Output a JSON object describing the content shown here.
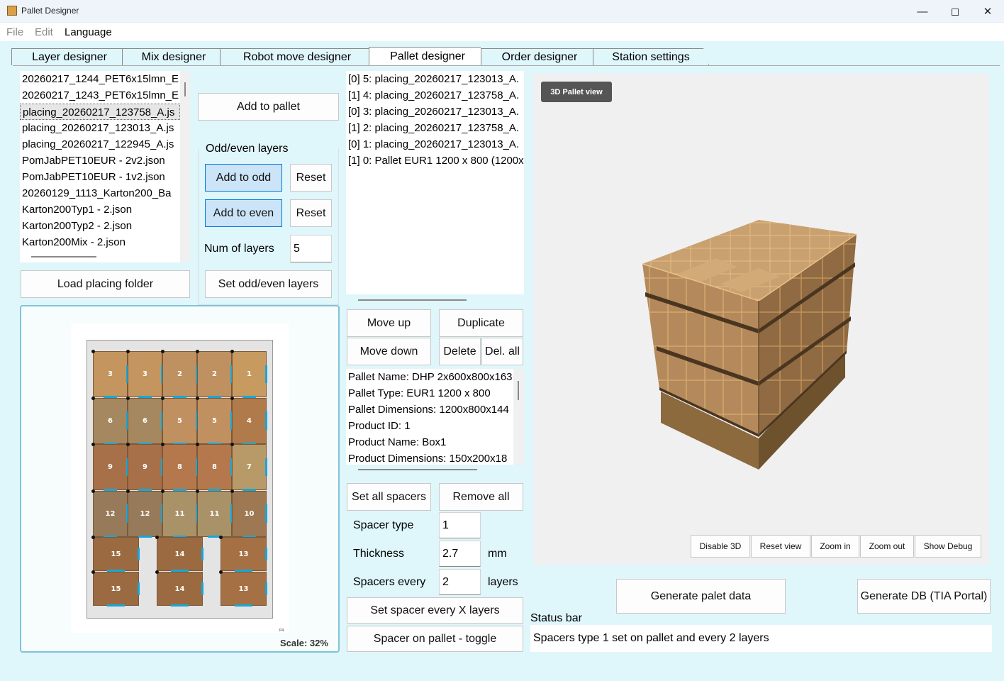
{
  "window": {
    "title": "Pallet Designer",
    "minimize_icon": "minimize-icon",
    "maximize_icon": "maximize-icon",
    "close_icon": "close-icon"
  },
  "menu": {
    "file": "File",
    "edit": "Edit",
    "language": "Language"
  },
  "tabs": [
    {
      "label": "Layer designer"
    },
    {
      "label": "Mix designer"
    },
    {
      "label": "Robot move designer"
    },
    {
      "label": "Pallet designer",
      "active": true
    },
    {
      "label": "Order designer"
    },
    {
      "label": "Station settings"
    }
  ],
  "placing_files": [
    "20260217_1244_PET6x15lmn_E",
    "20260217_1243_PET6x15lmn_E",
    "placing_20260217_123758_A.js",
    "placing_20260217_123013_A.js",
    "placing_20260217_122945_A.js",
    "PomJabPET10EUR - 2v2.json",
    "PomJabPET10EUR - 1v2.json",
    "20260129_1113_Karton200_Ba",
    "Karton200Typ1 - 2.json",
    "Karton200Typ2 - 2.json",
    "Karton200Mix - 2.json"
  ],
  "left": {
    "load_folder": "Load placing folder",
    "add_to_pallet": "Add to pallet"
  },
  "odd_even": {
    "group_title": "Odd/even layers",
    "add_odd": "Add to odd",
    "add_even": "Add to even",
    "reset": "Reset",
    "num_layers_label": "Num of layers",
    "num_layers_value": "5",
    "set_odd_even": "Set odd/even layers"
  },
  "layer_preview": {
    "scale_label": "Scale: 32%",
    "corner_mark": "P4",
    "boxes": [
      {
        "n": "3",
        "c": "#c4955e"
      },
      {
        "n": "3",
        "c": "#c4955e"
      },
      {
        "n": "2",
        "c": "#bf9060"
      },
      {
        "n": "2",
        "c": "#bf9060"
      },
      {
        "n": "1",
        "c": "#c79a60"
      },
      {
        "n": "6",
        "c": "#a58860"
      },
      {
        "n": "6",
        "c": "#a58860"
      },
      {
        "n": "5",
        "c": "#c09060"
      },
      {
        "n": "5",
        "c": "#c09060"
      },
      {
        "n": "4",
        "c": "#b07a4a"
      },
      {
        "n": "9",
        "c": "#a87048"
      },
      {
        "n": "9",
        "c": "#a87048"
      },
      {
        "n": "8",
        "c": "#b4784c"
      },
      {
        "n": "8",
        "c": "#b4784c"
      },
      {
        "n": "7",
        "c": "#b89a68"
      },
      {
        "n": "12",
        "c": "#967a5a"
      },
      {
        "n": "12",
        "c": "#967a5a"
      },
      {
        "n": "11",
        "c": "#aa9268"
      },
      {
        "n": "11",
        "c": "#aa9268"
      },
      {
        "n": "10",
        "c": "#9e7852"
      }
    ],
    "wide_boxes": [
      {
        "n": "15",
        "c": "#9c6a40"
      },
      {
        "n": "14",
        "c": "#9c6a40"
      },
      {
        "n": "13",
        "c": "#a57044"
      },
      {
        "n": "15",
        "c": "#9c6a40"
      },
      {
        "n": "14",
        "c": "#9c6a40"
      },
      {
        "n": "13",
        "c": "#a57044"
      }
    ]
  },
  "pallet_layers": [
    "[0] 5: placing_20260217_123013_A.",
    "[1] 4: placing_20260217_123758_A.",
    "[0] 3: placing_20260217_123013_A.",
    "[1] 2: placing_20260217_123758_A.",
    "[0] 1: placing_20260217_123013_A.",
    "[1] 0: Pallet EUR1 1200 x 800 (1200x"
  ],
  "layer_actions": {
    "move_up": "Move up",
    "duplicate": "Duplicate",
    "move_down": "Move down",
    "delete": "Delete",
    "del_all": "Del. all"
  },
  "pallet_info": [
    "Pallet Name: DHP 2x600x800x163",
    "Pallet Type: EUR1 1200 x 800",
    "Pallet Dimensions: 1200x800x144",
    "Product ID: 1",
    "Product Name: Box1",
    "Product Dimensions: 150x200x18"
  ],
  "spacers": {
    "set_all": "Set all spacers",
    "remove_all": "Remove all",
    "type_label": "Spacer type",
    "type_value": "1",
    "thickness_label": "Thickness",
    "thickness_value": "2.7",
    "thickness_unit": "mm",
    "every_label": "Spacers every",
    "every_value": "2",
    "every_unit": "layers",
    "set_every_x": "Set spacer every X layers",
    "on_pallet_toggle": "Spacer on pallet - toggle"
  },
  "view3d": {
    "tag": "3D Pallet view",
    "disable_3d": "Disable 3D",
    "reset_view": "Reset view",
    "zoom_in": "Zoom in",
    "zoom_out": "Zoom out",
    "show_debug": "Show Debug"
  },
  "generate": {
    "palet_data": "Generate palet data",
    "db": "Generate DB (TIA Portal)"
  },
  "status": {
    "label": "Status bar",
    "text": "Spacers type 1 set on pallet and every 2 layers"
  },
  "colors": {
    "accent": "#0078d4",
    "background": "#dff6fb",
    "button_selected": "#cce4f7",
    "carton": "#c49a6c"
  }
}
